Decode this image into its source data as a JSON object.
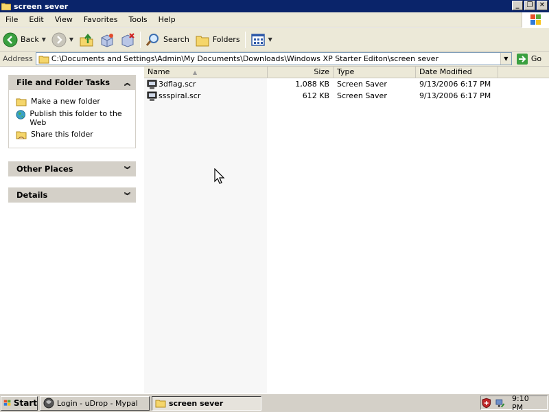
{
  "window": {
    "title": "screen sever"
  },
  "menu": [
    "File",
    "Edit",
    "View",
    "Favorites",
    "Tools",
    "Help"
  ],
  "toolbar": {
    "back_label": "Back",
    "search_label": "Search",
    "folders_label": "Folders"
  },
  "address": {
    "label": "Address",
    "value": "C:\\Documents and Settings\\Admin\\My Documents\\Downloads\\Windows XP Starter Editon\\screen sever",
    "go_label": "Go"
  },
  "tasks": {
    "header": "File and Folder Tasks",
    "items": [
      "Make a new folder",
      "Publish this folder to the Web",
      "Share this folder"
    ]
  },
  "other_places": {
    "header": "Other Places"
  },
  "details": {
    "header": "Details"
  },
  "columns": {
    "name": "Name",
    "size": "Size",
    "type": "Type",
    "date": "Date Modified"
  },
  "files": [
    {
      "name": "3dflag.scr",
      "size": "1,088 KB",
      "type": "Screen Saver",
      "date": "9/13/2006 6:17 PM"
    },
    {
      "name": "ssspiral.scr",
      "size": "612 KB",
      "type": "Screen Saver",
      "date": "9/13/2006 6:17 PM"
    }
  ],
  "taskbar": {
    "start_label": "Start",
    "items": [
      "Login - uDrop - Mypal",
      "screen sever"
    ],
    "clock": "9:10 PM"
  },
  "colors": {
    "titlebar": "#0a246a",
    "chrome": "#ece9d8",
    "panel_header": "#d4d0c8"
  }
}
